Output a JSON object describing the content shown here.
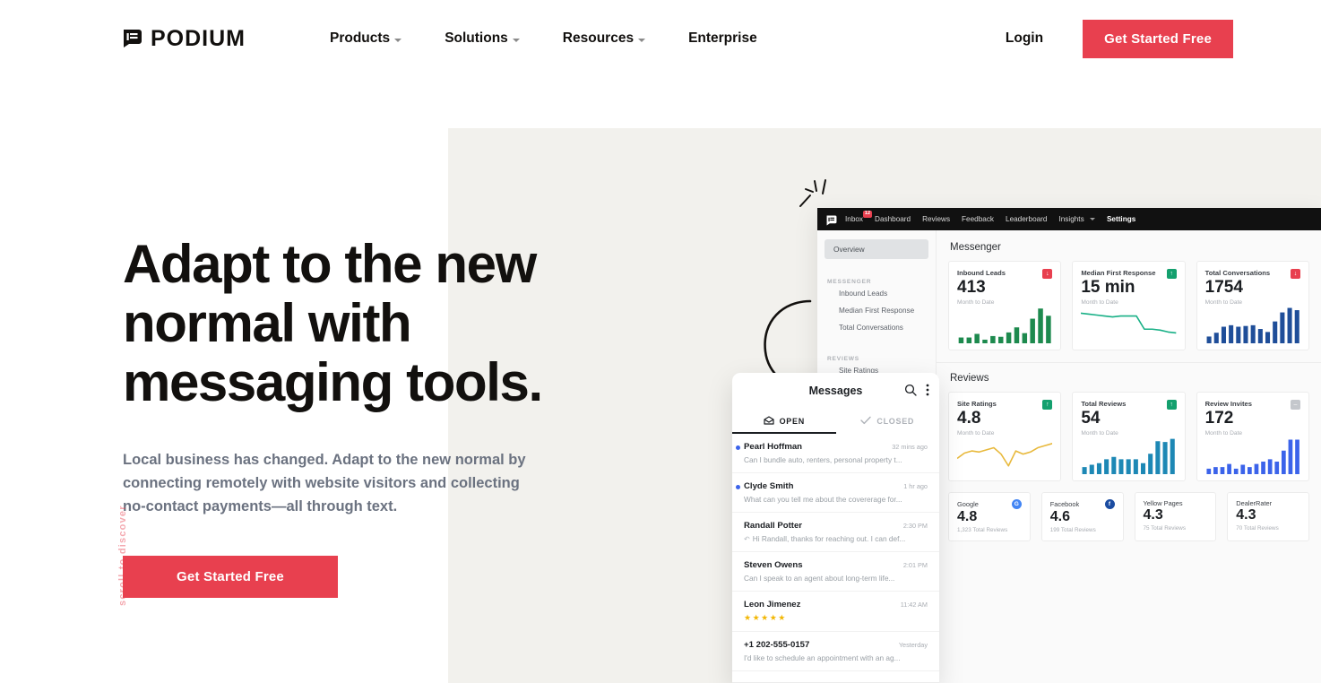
{
  "brand": {
    "name": "PODIUM",
    "logo_icon": "podium-speech-bubble-icon"
  },
  "nav": {
    "links": [
      {
        "label": "Products",
        "has_caret": true
      },
      {
        "label": "Solutions",
        "has_caret": true
      },
      {
        "label": "Resources",
        "has_caret": true
      },
      {
        "label": "Enterprise",
        "has_caret": false
      }
    ],
    "login_label": "Login",
    "cta_label": "Get Started Free"
  },
  "hero": {
    "title_line1": "Adapt to the new",
    "title_line2": "normal with",
    "title_line3": "messaging tools.",
    "subtitle": "Local business has changed. Adapt to the new normal by connecting remotely with website visitors and collecting no-contact payments—all through text.",
    "cta_label": "Get Started Free",
    "scroll_hint": "scroll to discover",
    "accent_color": "#e8404f",
    "panel_color": "#f2f1ed"
  },
  "app": {
    "topnav": {
      "logo_icon": "podium-speech-bubble-icon",
      "items": [
        {
          "label": "Inbox",
          "badge": "12",
          "active": false
        },
        {
          "label": "Dashboard",
          "active": false
        },
        {
          "label": "Reviews",
          "active": false
        },
        {
          "label": "Feedback",
          "active": false
        },
        {
          "label": "Leaderboard",
          "active": false
        },
        {
          "label": "Insights",
          "has_caret": true,
          "active": false
        },
        {
          "label": "Settings",
          "active": true
        }
      ]
    },
    "sidebar": {
      "overview_label": "Overview",
      "groups": [
        {
          "title": "MESSENGER",
          "items": [
            "Inbound Leads",
            "Median First Response",
            "Total Conversations"
          ]
        },
        {
          "title": "REVIEWS",
          "items": [
            "Site Ratings"
          ]
        }
      ]
    },
    "messenger_section": {
      "title": "Messenger",
      "cards": [
        {
          "label": "Inbound Leads",
          "value": "413",
          "sub": "Month to Date",
          "trend": "down",
          "trend_glyph": "↓",
          "chart": "bar",
          "color": "#1d8a4e"
        },
        {
          "label": "Median First Response",
          "value": "15 min",
          "sub": "Month to Date",
          "trend": "up",
          "trend_glyph": "↑",
          "chart": "line",
          "color": "#18b086"
        },
        {
          "label": "Total Conversations",
          "value": "1754",
          "sub": "Month to Date",
          "trend": "down",
          "trend_glyph": "↓",
          "chart": "bar",
          "color": "#1f4e99"
        }
      ]
    },
    "reviews_section": {
      "title": "Reviews",
      "cards": [
        {
          "label": "Site Ratings",
          "value": "4.8",
          "sub": "Month to Date",
          "trend": "up",
          "trend_glyph": "↑",
          "chart": "line",
          "color": "#e8b93c"
        },
        {
          "label": "Total Reviews",
          "value": "54",
          "sub": "Month to Date",
          "trend": "up",
          "trend_glyph": "↑",
          "chart": "bar",
          "color": "#1d88b5"
        },
        {
          "label": "Review Invites",
          "value": "172",
          "sub": "Month to Date",
          "trend": "flat",
          "trend_glyph": "–",
          "chart": "bar",
          "color": "#3b63ea"
        }
      ]
    },
    "sites": [
      {
        "name": "Google",
        "rating": "4.8",
        "reviews": "1,323 Total Reviews",
        "badge": "G",
        "badge_icon": "google-icon"
      },
      {
        "name": "Facebook",
        "rating": "4.6",
        "reviews": "199 Total Reviews",
        "badge": "f",
        "badge_icon": "facebook-icon"
      },
      {
        "name": "Yellow Pages",
        "rating": "4.3",
        "reviews": "75 Total Reviews",
        "badge": "",
        "badge_icon": ""
      },
      {
        "name": "DealerRater",
        "rating": "4.3",
        "reviews": "70 Total Reviews",
        "badge": "",
        "badge_icon": ""
      }
    ]
  },
  "messages": {
    "title": "Messages",
    "search_icon": "search-icon",
    "more_icon": "more-vertical-icon",
    "tabs": [
      {
        "label": "OPEN",
        "icon": "open-envelope-icon",
        "active": true
      },
      {
        "label": "CLOSED",
        "icon": "check-icon",
        "active": false
      }
    ],
    "items": [
      {
        "name": "Pearl Hoffman",
        "time": "32 mins ago",
        "preview": "Can I bundle auto, renters, personal property t...",
        "unread": true
      },
      {
        "name": "Clyde Smith",
        "time": "1 hr ago",
        "preview": "What can you tell me about the covererage for...",
        "unread": true
      },
      {
        "name": "Randall Potter",
        "time": "2:30 PM",
        "preview": "Hi Randall, thanks for reaching out. I can def...",
        "unread": false,
        "replied": true
      },
      {
        "name": "Steven Owens",
        "time": "2:01 PM",
        "preview": "Can I speak to an agent about long-term life...",
        "unread": false
      },
      {
        "name": "Leon Jimenez",
        "time": "11:42 AM",
        "preview": "",
        "unread": false,
        "stars": "★★★★★"
      },
      {
        "name": "+1 202-555-0157",
        "time": "Yesterday",
        "preview": "I'd like to schedule an appointment with an ag...",
        "unread": false
      }
    ]
  },
  "chart_data": [
    {
      "type": "bar",
      "title": "Inbound Leads",
      "values": [
        8,
        8,
        13,
        5,
        10,
        9,
        15,
        22,
        14,
        34,
        48,
        38
      ],
      "color": "#1d8a4e",
      "ylim": [
        0,
        52
      ]
    },
    {
      "type": "line",
      "title": "Median First Response",
      "values": [
        30,
        29,
        28,
        27,
        26,
        27,
        27,
        27,
        13,
        13,
        12,
        10,
        9
      ],
      "color": "#18b086",
      "ylim": [
        0,
        34
      ]
    },
    {
      "type": "bar",
      "title": "Total Conversations",
      "values": [
        9,
        14,
        22,
        24,
        22,
        23,
        24,
        19,
        15,
        29,
        41,
        47,
        44
      ],
      "color": "#1f4e99",
      "ylim": [
        0,
        50
      ]
    },
    {
      "type": "line",
      "title": "Site Ratings",
      "values": [
        13,
        18,
        20,
        19,
        21,
        23,
        17,
        6,
        20,
        17,
        19,
        23,
        25,
        27
      ],
      "color": "#e8b93c",
      "ylim": [
        0,
        30
      ]
    },
    {
      "type": "bar",
      "title": "Total Reviews",
      "values": [
        9,
        12,
        14,
        19,
        22,
        19,
        19,
        19,
        14,
        26,
        42,
        41,
        45
      ],
      "color": "#1d88b5",
      "ylim": [
        0,
        48
      ]
    },
    {
      "type": "bar",
      "title": "Review Invites",
      "values": [
        7,
        9,
        9,
        13,
        7,
        12,
        9,
        13,
        16,
        19,
        16,
        30,
        44,
        44
      ],
      "color": "#3b63ea",
      "ylim": [
        0,
        48
      ]
    }
  ]
}
